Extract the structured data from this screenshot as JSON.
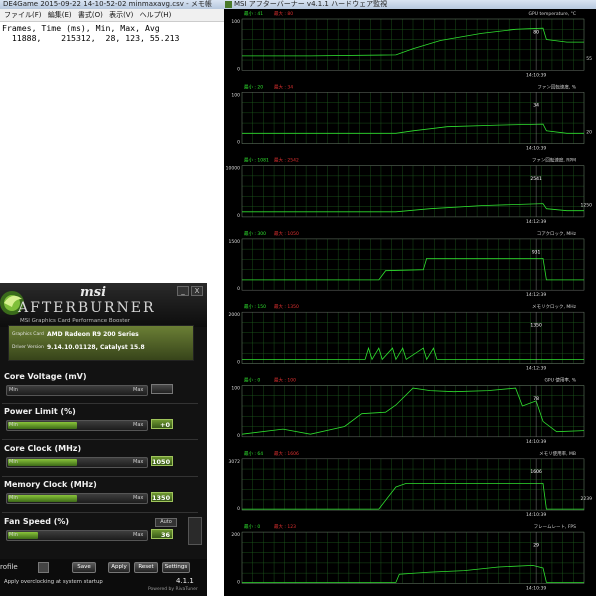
{
  "notepad": {
    "title": "DE4Game 2015-09-22 14-10-52-02 minmaxavg.csv - メモ帳",
    "menu": [
      "ファイル(F)",
      "編集(E)",
      "書式(O)",
      "表示(V)",
      "ヘルプ(H)"
    ],
    "lines": [
      "Frames, Time (ms), Min, Max, Avg",
      "  11888,    215312,  28, 123, 55.213"
    ]
  },
  "afterburner": {
    "brand": "msi",
    "name": "AFTERBURNER",
    "subtitle": "MSI Graphics Card Performance Booster",
    "graphics_card_label": "Graphics Card",
    "graphics_card": "AMD Radeon R9 200 Series",
    "driver_label": "Driver Version",
    "driver": "9.14.10.01128, Catalyst 15.8",
    "min_label": "Min",
    "max_label": "Max",
    "sliders": [
      {
        "title": "Core Voltage (mV)",
        "value": "",
        "fill": 0.0
      },
      {
        "title": "Power Limit (%)",
        "value": "+0",
        "fill": 0.5
      },
      {
        "title": "Core Clock (MHz)",
        "value": "1050",
        "fill": 0.5
      },
      {
        "title": "Memory Clock (MHz)",
        "value": "1350",
        "fill": 0.5
      },
      {
        "title": "Fan Speed (%)",
        "value": "36",
        "fill": 0.22
      }
    ],
    "auto_label": "Auto",
    "profile_label": "rofile",
    "buttons": [
      "Save",
      "Apply",
      "Reset",
      "Settings"
    ],
    "startup": "Apply overclocking at system startup",
    "version": "4.1.1",
    "powered": "Powered by RivaTuner",
    "window_controls": [
      "_",
      "X"
    ]
  },
  "monitor": {
    "title": "MSI アフターバーナー v4.1.1 ハードウェア監視",
    "accent": "#2fe02f",
    "grid_color": "#1f5f1f",
    "graphs": [
      {
        "min": "最小 : 41",
        "max": "最大 : 80",
        "name": "GPU temperature, °C",
        "ymax": "100",
        "ymin": "0",
        "right": "55",
        "peak": "80",
        "time": "14:10:39"
      },
      {
        "min": "最小 : 20",
        "max": "最大 : 34",
        "name": "ファン回転速度, %",
        "ymax": "100",
        "ymin": "0",
        "right": "20",
        "peak": "34",
        "time": "14:10:39"
      },
      {
        "min": "最小 : 1081",
        "max": "最大 : 2542",
        "name": "ファン回転速度, RPM",
        "ymax": "10000",
        "ymin": "0",
        "right": "1250",
        "peak": "2541",
        "time": "14:12:39"
      },
      {
        "min": "最小 : 300",
        "max": "最大 : 1050",
        "name": "コアクロック, MHz",
        "ymax": "1500",
        "ymin": "0",
        "right": "",
        "peak": "931",
        "time": "14:12:39"
      },
      {
        "min": "最小 : 150",
        "max": "最大 : 1350",
        "name": "メモリクロック, MHz",
        "ymax": "2000",
        "ymin": "0",
        "right": "",
        "peak": "1350",
        "time": "14:12:39"
      },
      {
        "min": "最小 : 0",
        "max": "最大 : 100",
        "name": "GPU 使用率, %",
        "ymax": "100",
        "ymin": "0",
        "right": "",
        "peak": "78",
        "time": "14:10:39"
      },
      {
        "min": "最小 : 64",
        "max": "最大 : 1606",
        "name": "メモリ使用率, MB",
        "ymax": "3072",
        "ymin": "0",
        "right": "2239",
        "peak": "1606",
        "time": "14:10:39"
      },
      {
        "min": "最小 : 0",
        "max": "最大 : 123",
        "name": "フレームレート, FPS",
        "ymax": "200",
        "ymin": "0",
        "right": "",
        "peak": "29",
        "time": "14:10:39"
      }
    ]
  }
}
